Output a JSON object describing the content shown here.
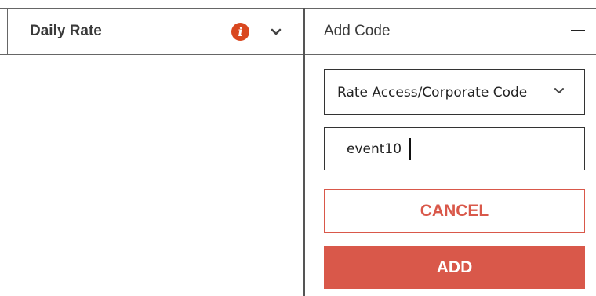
{
  "rate_panel": {
    "label": "Daily Rate",
    "info_icon": "info-icon",
    "expand_icon": "chevron-down-icon"
  },
  "add_code_panel": {
    "title": "Add Code",
    "collapse_icon": "minus-icon",
    "code_type_select": {
      "selected": "Rate Access/Corporate Code",
      "icon": "chevron-down-icon"
    },
    "code_input": {
      "value": "event10"
    },
    "cancel_label": "CANCEL",
    "add_label": "ADD"
  },
  "colors": {
    "accent": "#d9584a",
    "info": "#d9471f",
    "border": "#333333"
  }
}
